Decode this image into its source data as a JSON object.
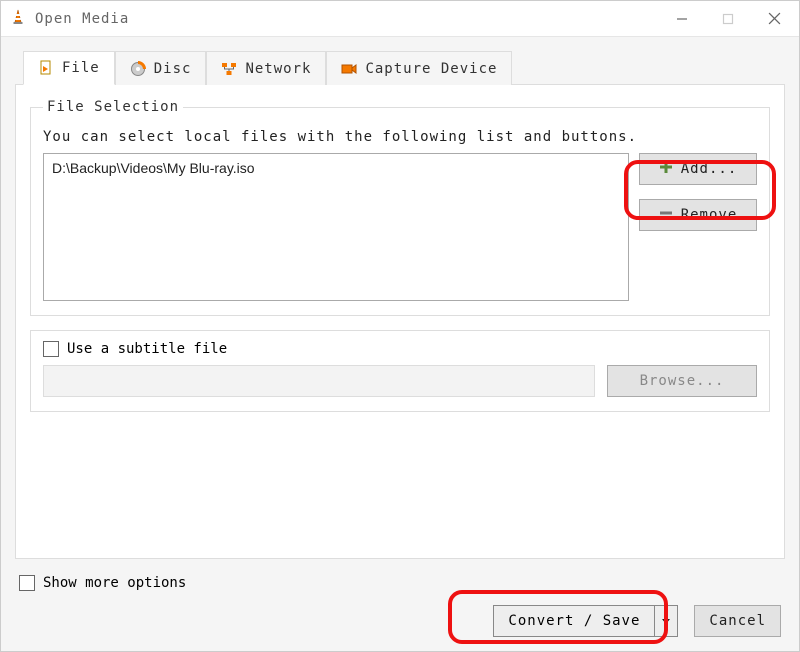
{
  "titlebar": {
    "title": "Open Media"
  },
  "tabs": {
    "file": "File",
    "disc": "Disc",
    "network": "Network",
    "capture": "Capture Device"
  },
  "fileSelection": {
    "legend": "File Selection",
    "hint": "You can select local files with the following list and buttons.",
    "entries": [
      "D:\\Backup\\Videos\\My Blu-ray.iso"
    ],
    "add": "Add...",
    "remove": "Remove"
  },
  "subtitle": {
    "label": "Use a subtitle file",
    "browse": "Browse..."
  },
  "options": {
    "showMore": "Show more options"
  },
  "footer": {
    "convert": "Convert / Save",
    "cancel": "Cancel"
  }
}
